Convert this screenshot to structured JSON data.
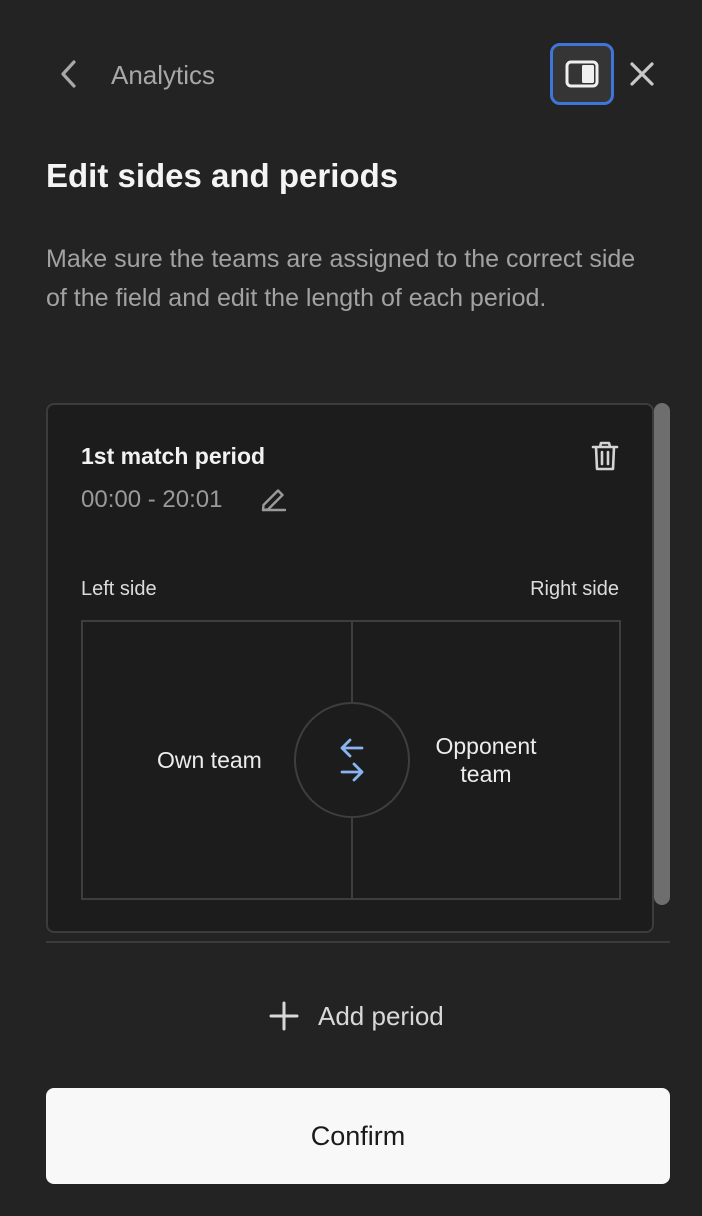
{
  "header": {
    "back_icon": "chevron-left-icon",
    "title": "Analytics",
    "panel_icon": "panel-toggle-icon",
    "close_icon": "close-icon",
    "accent_color": "#3f74d8"
  },
  "page": {
    "title": "Edit sides and periods",
    "description": "Make sure the teams are assigned to the correct side of the field and edit the length of each period."
  },
  "periods": [
    {
      "title": "1st match period",
      "time_range": "00:00 - 20:01",
      "edit_icon": "pencil-icon",
      "delete_icon": "trash-icon",
      "left_side_label": "Left side",
      "right_side_label": "Right side",
      "left_team": "Own team",
      "right_team": "Opponent team",
      "swap_icon": "swap-arrows-icon",
      "swap_color": "#8ab4f0"
    }
  ],
  "actions": {
    "add_period_icon": "plus-icon",
    "add_period_label": "Add period",
    "confirm_label": "Confirm"
  }
}
